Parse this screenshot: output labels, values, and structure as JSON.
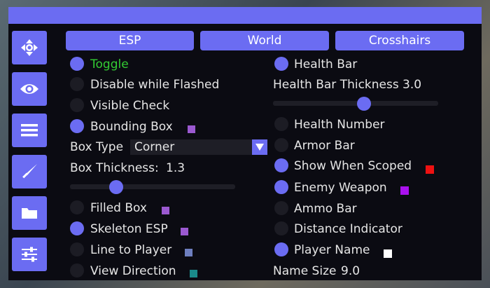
{
  "tabs": [
    "ESP",
    "World",
    "Crosshairs"
  ],
  "sidebar": {
    "icons": [
      "move-icon",
      "eye-icon",
      "menu-icon",
      "knife-icon",
      "folder-icon",
      "sliders-icon"
    ],
    "selected_index": 1
  },
  "left": {
    "toggle": {
      "label": "Toggle",
      "on": true,
      "color": "#33cc33"
    },
    "disable_while_flashed": {
      "label": "Disable while Flashed",
      "on": false
    },
    "visible_check": {
      "label": "Visible Check",
      "on": false
    },
    "bounding_box": {
      "label": "Bounding Box",
      "on": true,
      "color": "#9b59d0"
    },
    "box_type": {
      "label": "Box Type",
      "value": "Corner"
    },
    "box_thickness": {
      "label": "Box Thickness:",
      "value": "1.3",
      "fraction": 0.28
    },
    "filled_box": {
      "label": "Filled Box",
      "on": false,
      "color": "#9b59d0"
    },
    "skeleton_esp": {
      "label": "Skeleton ESP",
      "on": true,
      "color": "#9b59d0"
    },
    "line_to_player": {
      "label": "Line to Player",
      "on": false,
      "color": "#6e7fbf"
    },
    "view_direction": {
      "label": "View Direction",
      "on": false,
      "color": "#1a8a8a"
    }
  },
  "right": {
    "health_bar": {
      "label": "Health Bar",
      "on": true
    },
    "health_bar_thickness": {
      "label": "Health Bar Thickness",
      "value": "3.0",
      "fraction": 0.55
    },
    "health_number": {
      "label": "Health Number",
      "on": false
    },
    "armor_bar": {
      "label": "Armor Bar",
      "on": false
    },
    "show_when_scoped": {
      "label": "Show When Scoped",
      "on": true,
      "color": "#ee1111"
    },
    "enemy_weapon": {
      "label": "Enemy Weapon",
      "on": true,
      "color": "#aa11ee"
    },
    "ammo_bar": {
      "label": "Ammo Bar",
      "on": false
    },
    "distance_indicator": {
      "label": "Distance Indicator",
      "on": false
    },
    "player_name": {
      "label": "Player Name",
      "on": true,
      "color": "#ffffff"
    },
    "name_size": {
      "label": "Name Size",
      "value": "9.0"
    }
  },
  "colors": {
    "accent": "#6b6cf2",
    "panel": "#0b0b12",
    "off": "#1c1c24"
  }
}
